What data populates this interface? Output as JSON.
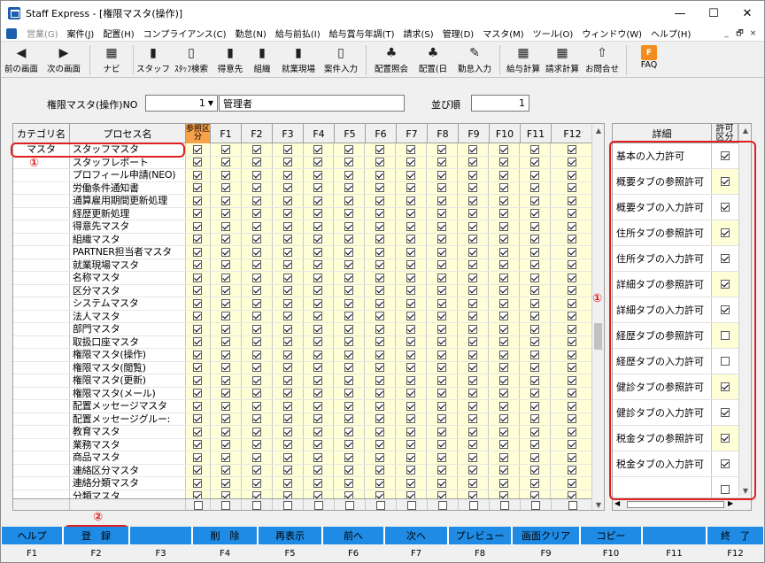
{
  "window": {
    "title": "Staff Express - [権限マスタ(操作)]",
    "controls": [
      "—",
      "☐",
      "✕"
    ]
  },
  "menu": [
    "営業(G)",
    "案件(J)",
    "配置(H)",
    "コンプライアンス(C)",
    "勤怠(N)",
    "給与前払(I)",
    "給与賞与年調(T)",
    "請求(S)",
    "管理(D)",
    "マスタ(M)",
    "ツール(O)",
    "ウィンドウ(W)",
    "ヘルプ(H)"
  ],
  "mdi": [
    "_",
    "🗗",
    "×"
  ],
  "toolbar": [
    {
      "icon": "◀",
      "label": "前の画面"
    },
    {
      "icon": "▶",
      "label": "次の画面"
    },
    {
      "icon": "▦",
      "label": "ナビ"
    },
    {
      "icon": "▮",
      "label": "スタッフ"
    },
    {
      "icon": "▯",
      "label": "ｽﾀｯﾌ検索"
    },
    {
      "icon": "▮",
      "label": "得意先"
    },
    {
      "icon": "▮",
      "label": "組織"
    },
    {
      "icon": "▮",
      "label": "就業現場"
    },
    {
      "icon": "▯",
      "label": "案件入力"
    },
    {
      "icon": "♣",
      "label": "配置照会"
    },
    {
      "icon": "♣",
      "label": "配置(日"
    },
    {
      "icon": "✎",
      "label": "勤怠入力"
    },
    {
      "icon": "▦",
      "label": "給与計算"
    },
    {
      "icon": "▦",
      "label": "請求計算"
    },
    {
      "icon": "⇧",
      "label": "お問合せ"
    },
    {
      "icon": "FAQ",
      "label": "FAQ"
    }
  ],
  "header": {
    "no_label": "権限マスタ(操作)NO",
    "no_value": "1",
    "name_value": "管理者",
    "order_label": "並び順",
    "order_value": "1"
  },
  "grid": {
    "columns": [
      "カテゴリ名",
      "プロセス名",
      "参照区分",
      "F1",
      "F2",
      "F3",
      "F4",
      "F5",
      "F6",
      "F7",
      "F8",
      "F9",
      "F10",
      "F11",
      "F12"
    ],
    "rows": [
      {
        "cat": "マスタ",
        "proc": "スタッフマスタ"
      },
      {
        "cat": "",
        "proc": "スタッフレポート"
      },
      {
        "cat": "",
        "proc": "プロフィール申請(NEO)"
      },
      {
        "cat": "",
        "proc": "労働条件通知書"
      },
      {
        "cat": "",
        "proc": "通算雇用期間更新処理"
      },
      {
        "cat": "",
        "proc": "経歴更新処理"
      },
      {
        "cat": "",
        "proc": "得意先マスタ"
      },
      {
        "cat": "",
        "proc": "組織マスタ"
      },
      {
        "cat": "",
        "proc": "PARTNER担当者マスタ"
      },
      {
        "cat": "",
        "proc": "就業現場マスタ"
      },
      {
        "cat": "",
        "proc": "名称マスタ"
      },
      {
        "cat": "",
        "proc": "区分マスタ"
      },
      {
        "cat": "",
        "proc": "システムマスタ"
      },
      {
        "cat": "",
        "proc": "法人マスタ"
      },
      {
        "cat": "",
        "proc": "部門マスタ"
      },
      {
        "cat": "",
        "proc": "取扱口座マスタ"
      },
      {
        "cat": "",
        "proc": "権限マスタ(操作)"
      },
      {
        "cat": "",
        "proc": "権限マスタ(閲覧)"
      },
      {
        "cat": "",
        "proc": "権限マスタ(更新)"
      },
      {
        "cat": "",
        "proc": "権限マスタ(メール)"
      },
      {
        "cat": "",
        "proc": "配置メッセージマスタ"
      },
      {
        "cat": "",
        "proc": "配置メッセージグルー:"
      },
      {
        "cat": "",
        "proc": "教育マスタ"
      },
      {
        "cat": "",
        "proc": "業務マスタ"
      },
      {
        "cat": "",
        "proc": "商品マスタ"
      },
      {
        "cat": "",
        "proc": "連絡区分マスタ"
      },
      {
        "cat": "",
        "proc": "連絡分類マスタ"
      },
      {
        "cat": "",
        "proc": "分類マスタ"
      }
    ]
  },
  "detail": {
    "col_detail": "詳細",
    "col_perm": "許可区分",
    "items": [
      {
        "label": "基本の入力許可",
        "checked": true,
        "yellow": false
      },
      {
        "label": "概要タブの参照許可",
        "checked": true,
        "yellow": true
      },
      {
        "label": "概要タブの入力許可",
        "checked": true,
        "yellow": false
      },
      {
        "label": "住所タブの参照許可",
        "checked": true,
        "yellow": true
      },
      {
        "label": "住所タブの入力許可",
        "checked": true,
        "yellow": false
      },
      {
        "label": "詳細タブの参照許可",
        "checked": true,
        "yellow": true
      },
      {
        "label": "詳細タブの入力許可",
        "checked": true,
        "yellow": false
      },
      {
        "label": "経歴タブの参照許可",
        "checked": false,
        "yellow": true
      },
      {
        "label": "経歴タブの入力許可",
        "checked": false,
        "yellow": false
      },
      {
        "label": "健診タブの参照許可",
        "checked": true,
        "yellow": true
      },
      {
        "label": "健診タブの入力許可",
        "checked": true,
        "yellow": false
      },
      {
        "label": "税金タブの参照許可",
        "checked": true,
        "yellow": true
      },
      {
        "label": "税金タブの入力許可",
        "checked": true,
        "yellow": false
      }
    ]
  },
  "annotations": {
    "mark1": "①",
    "mark2": "②"
  },
  "fkeys": [
    {
      "label": "ヘルプ",
      "key": "F1"
    },
    {
      "label": "登　録",
      "key": "F2"
    },
    {
      "label": "",
      "key": "F3"
    },
    {
      "label": "削　除",
      "key": "F4"
    },
    {
      "label": "再表示",
      "key": "F5"
    },
    {
      "label": "前へ",
      "key": "F6"
    },
    {
      "label": "次へ",
      "key": "F7"
    },
    {
      "label": "プレビュー",
      "key": "F8"
    },
    {
      "label": "画面クリア",
      "key": "F9"
    },
    {
      "label": "コピー",
      "key": "F10"
    },
    {
      "label": "",
      "key": "F11"
    },
    {
      "label": "終　了",
      "key": "F12"
    }
  ],
  "colors": {
    "accent": "#1f8be5",
    "highlight": "#f7a24b",
    "annotation": "#e02020",
    "cell_yellow": "#ffffd7"
  }
}
